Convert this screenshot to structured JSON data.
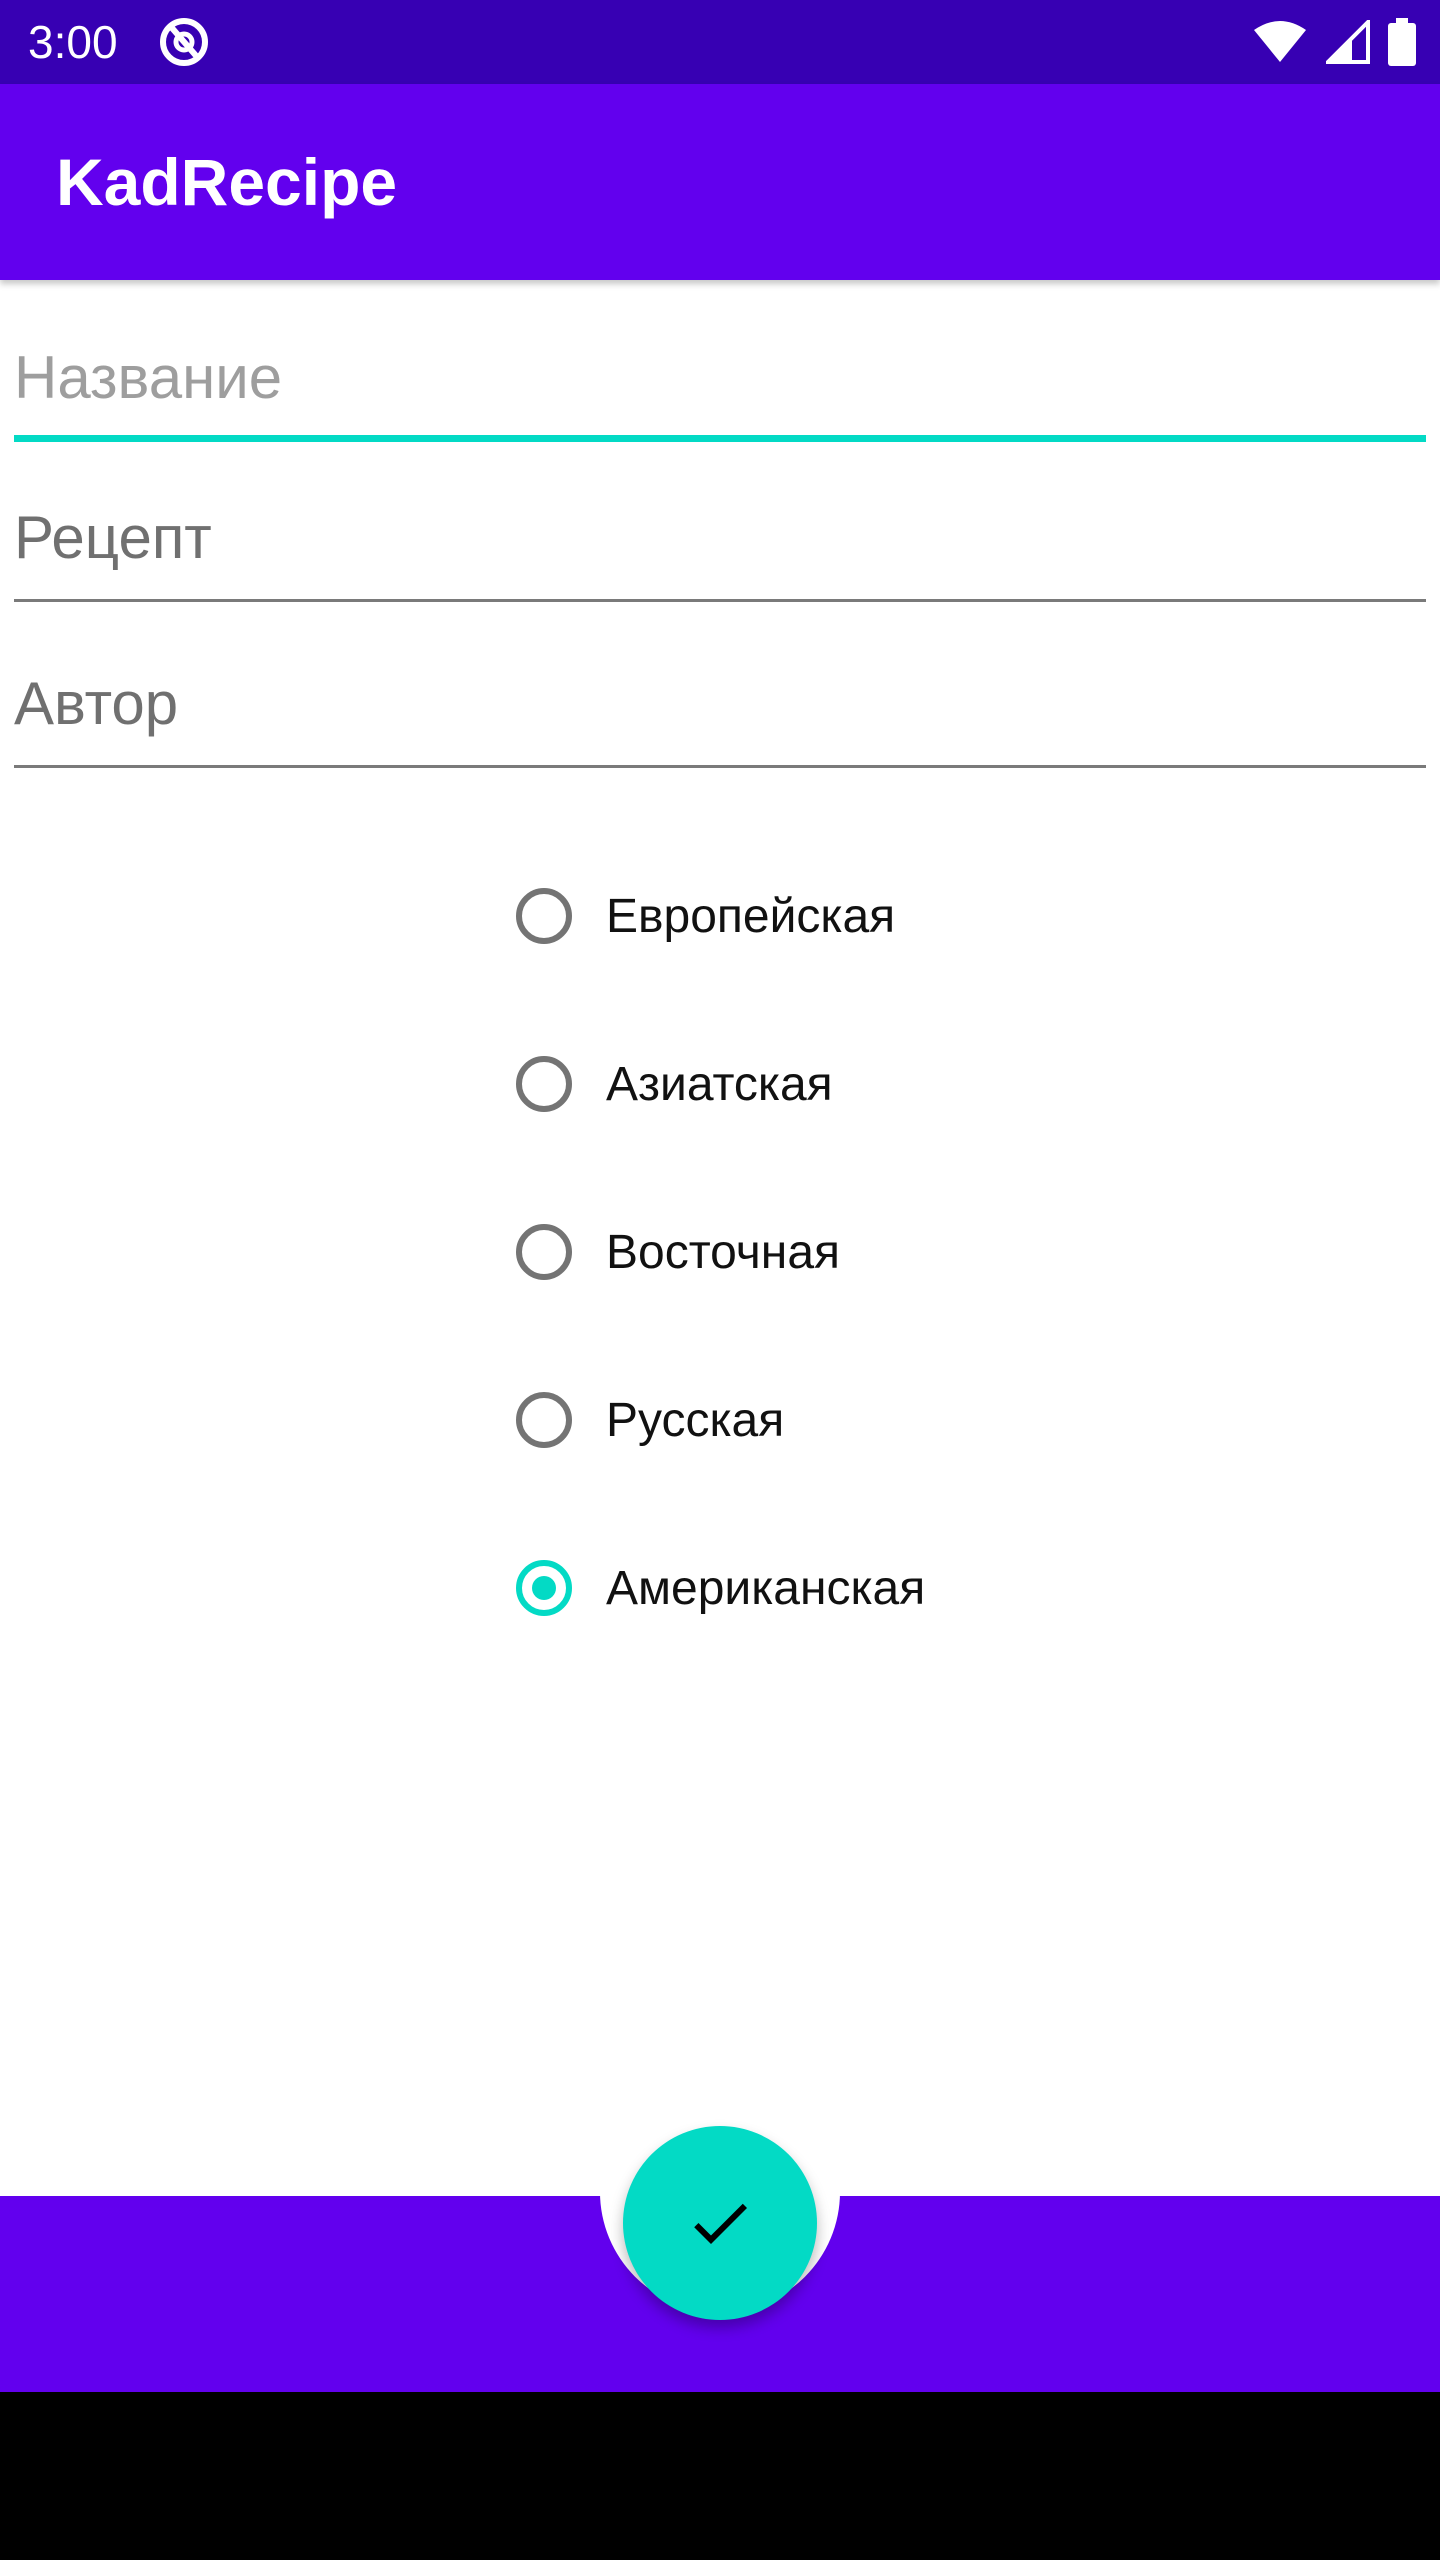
{
  "status_bar": {
    "time": "3:00",
    "icons": [
      "app-notification-icon",
      "wifi-icon",
      "cell-signal-icon",
      "battery-icon"
    ]
  },
  "app_bar": {
    "title": "KadRecipe"
  },
  "form": {
    "name": {
      "placeholder": "Название",
      "value": ""
    },
    "recipe": {
      "placeholder": "Рецепт",
      "value": ""
    },
    "author": {
      "placeholder": "Автор",
      "value": ""
    }
  },
  "cuisines": [
    {
      "label": "Европейская",
      "checked": false
    },
    {
      "label": "Азиатская",
      "checked": false
    },
    {
      "label": "Восточная",
      "checked": false
    },
    {
      "label": "Русская",
      "checked": false
    },
    {
      "label": "Американская",
      "checked": true
    }
  ],
  "fab": {
    "icon": "check-icon"
  },
  "colors": {
    "status_bar": "#3700b3",
    "primary": "#6200ee",
    "accent": "#03dac5",
    "nav_bar": "#000000"
  }
}
